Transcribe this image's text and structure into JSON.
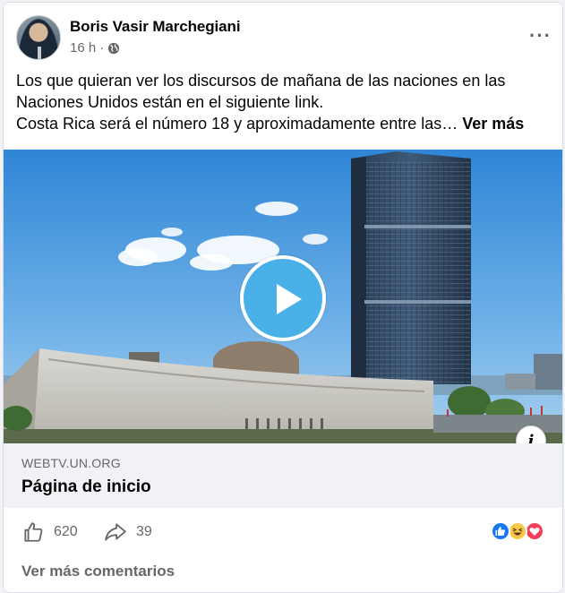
{
  "post": {
    "author": "Boris Vasir Marchegiani",
    "time": "16 h",
    "separator": "·",
    "audience_icon": "globe-icon",
    "more_icon": "···",
    "text_line1": "Los que quieran ver los discursos de mañana de las naciones en las",
    "text_line2": "Naciones Unidos están en el siguiente link.",
    "text_line3": "Costa Rica será el número 18 y aproximadamente entre las…",
    "see_more": "Ver más"
  },
  "link_preview": {
    "domain": "WEBTV.UN.ORG",
    "title": "Página de inicio",
    "info_icon": "i"
  },
  "actions": {
    "like_count": "620",
    "share_count": "39",
    "reactions": [
      "like-reaction-icon",
      "haha-reaction-icon",
      "love-reaction-icon"
    ]
  },
  "comments": {
    "see_more_label": "Ver más comentarios"
  },
  "colors": {
    "play_button": "#49b1e8",
    "like_blue": "#1877f2",
    "love_red": "#f33e58",
    "haha_yellow": "#f7c94a",
    "secondary_text": "#65676b"
  }
}
